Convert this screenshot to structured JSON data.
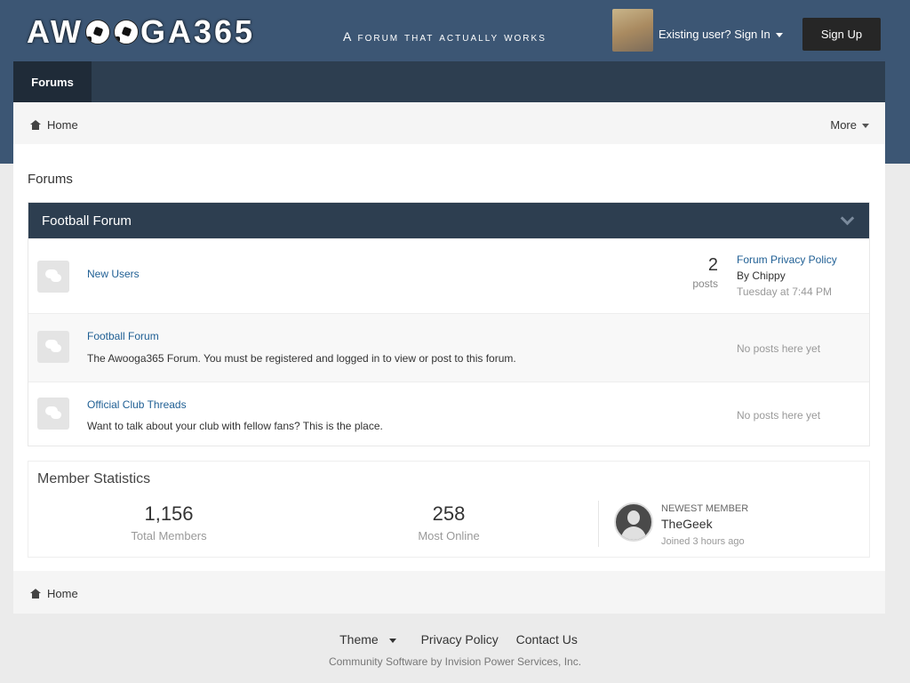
{
  "header": {
    "logo_text_left": "AW",
    "logo_text_right": "GA365",
    "tagline": "A forum that actually works",
    "signin_label": "Existing user? Sign In",
    "signup_label": "Sign Up"
  },
  "nav": {
    "tabs": [
      {
        "label": "Forums"
      }
    ]
  },
  "breadcrumb": {
    "home_label": "Home",
    "more_label": "More"
  },
  "page_title": "Forums",
  "category": {
    "title": "Football Forum",
    "forums": [
      {
        "name": "New Users",
        "description": "",
        "post_count": "2",
        "post_count_label": "posts",
        "last_post_title": "Forum Privacy Policy",
        "last_post_by": "By Chippy",
        "last_post_date": "Tuesday at 7:44 PM"
      },
      {
        "name": "Football Forum",
        "description": "The Awooga365 Forum. You must be registered and logged in to view or post to this forum.",
        "no_posts": "No posts here yet"
      },
      {
        "name": "Official Club Threads",
        "description": "Want to talk about your club with fellow fans? This is the place.",
        "no_posts": "No posts here yet"
      }
    ]
  },
  "stats": {
    "title": "Member Statistics",
    "total_members": "1,156",
    "total_members_label": "Total Members",
    "most_online": "258",
    "most_online_label": "Most Online",
    "newest_label": "Newest Member",
    "newest_name": "TheGeek",
    "newest_joined": "Joined 3 hours ago"
  },
  "footer": {
    "theme_label": "Theme",
    "privacy_label": "Privacy Policy",
    "contact_label": "Contact Us",
    "copyright": "Community Software by Invision Power Services, Inc."
  }
}
